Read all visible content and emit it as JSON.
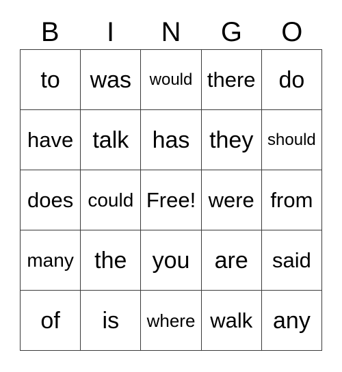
{
  "card": {
    "title": "BINGO",
    "header_letters": [
      "B",
      "I",
      "N",
      "G",
      "O"
    ],
    "free_space_label": "Free!",
    "grid": {
      "rows": 5,
      "columns": 5,
      "cells": [
        [
          {
            "text": "to",
            "size": "xl"
          },
          {
            "text": "was",
            "size": "xl"
          },
          {
            "text": "would",
            "size": "xs"
          },
          {
            "text": "there",
            "size": "lg"
          },
          {
            "text": "do",
            "size": "xl"
          }
        ],
        [
          {
            "text": "have",
            "size": "lg"
          },
          {
            "text": "talk",
            "size": "xl"
          },
          {
            "text": "has",
            "size": "xl"
          },
          {
            "text": "they",
            "size": "xl"
          },
          {
            "text": "should",
            "size": "xs"
          }
        ],
        [
          {
            "text": "does",
            "size": "lg"
          },
          {
            "text": "could",
            "size": "md"
          },
          {
            "text": "Free!",
            "size": "lg"
          },
          {
            "text": "were",
            "size": "lg"
          },
          {
            "text": "from",
            "size": "lg"
          }
        ],
        [
          {
            "text": "many",
            "size": "md"
          },
          {
            "text": "the",
            "size": "xl"
          },
          {
            "text": "you",
            "size": "xl"
          },
          {
            "text": "are",
            "size": "xl"
          },
          {
            "text": "said",
            "size": "lg"
          }
        ],
        [
          {
            "text": "of",
            "size": "xl"
          },
          {
            "text": "is",
            "size": "xl"
          },
          {
            "text": "where",
            "size": "sm"
          },
          {
            "text": "walk",
            "size": "lg"
          },
          {
            "text": "any",
            "size": "xl"
          }
        ]
      ]
    },
    "colors": {
      "background": "#ffffff",
      "text": "#000000",
      "border": "#3a3a3a"
    }
  }
}
